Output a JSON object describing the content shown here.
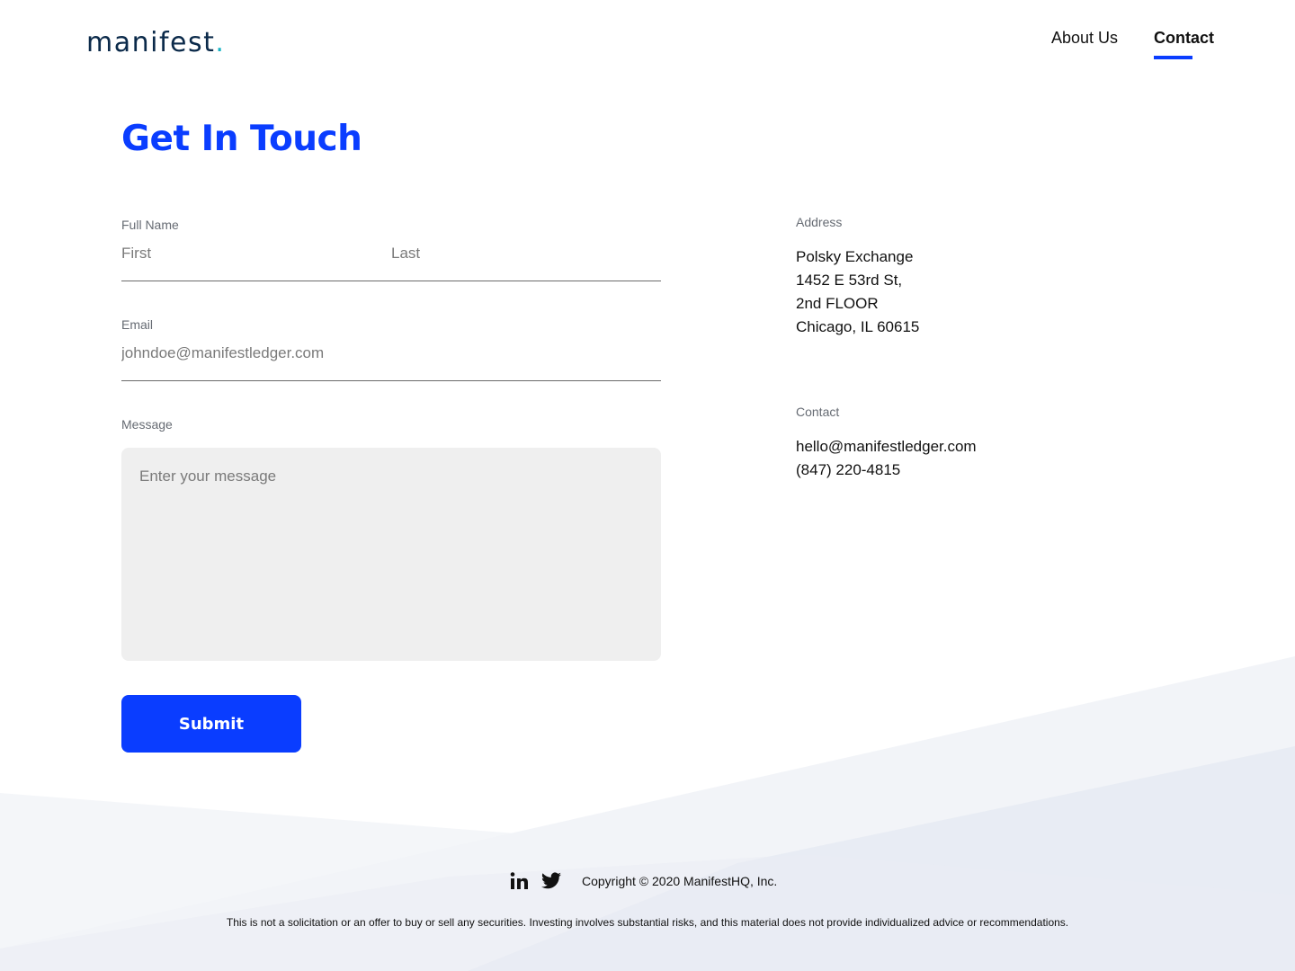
{
  "header": {
    "logo_text": "manifest",
    "logo_dot": ".",
    "nav": [
      {
        "label": "About Us",
        "active": false
      },
      {
        "label": "Contact",
        "active": true
      }
    ]
  },
  "main": {
    "title": "Get In Touch"
  },
  "form": {
    "full_name_label": "Full Name",
    "first_placeholder": "First",
    "last_placeholder": "Last",
    "email_label": "Email",
    "email_placeholder": "johndoe@manifestledger.com",
    "message_label": "Message",
    "message_placeholder": "Enter your message",
    "submit_label": "Submit"
  },
  "address": {
    "label": "Address",
    "lines": [
      "Polsky Exchange",
      "1452 E 53rd St,",
      "2nd FLOOR",
      "Chicago, IL 60615"
    ]
  },
  "contact": {
    "label": "Contact",
    "email": "hello@manifestledger.com",
    "phone": "(847) 220-4815"
  },
  "footer": {
    "social_icons": [
      "linkedin-icon",
      "twitter-icon"
    ],
    "copyright": "Copyright © 2020 ManifestHQ, Inc.",
    "disclaimer": "This is not a solicitation or an offer to buy or sell any securities. Investing involves substantial risks, and this material does not provide individualized advice or recommendations."
  },
  "colors": {
    "accent": "#0a3dff",
    "logo": "#0b2a4a",
    "logo_dot": "#16b3c4",
    "label": "#666b73",
    "message_bg": "#efefef"
  }
}
